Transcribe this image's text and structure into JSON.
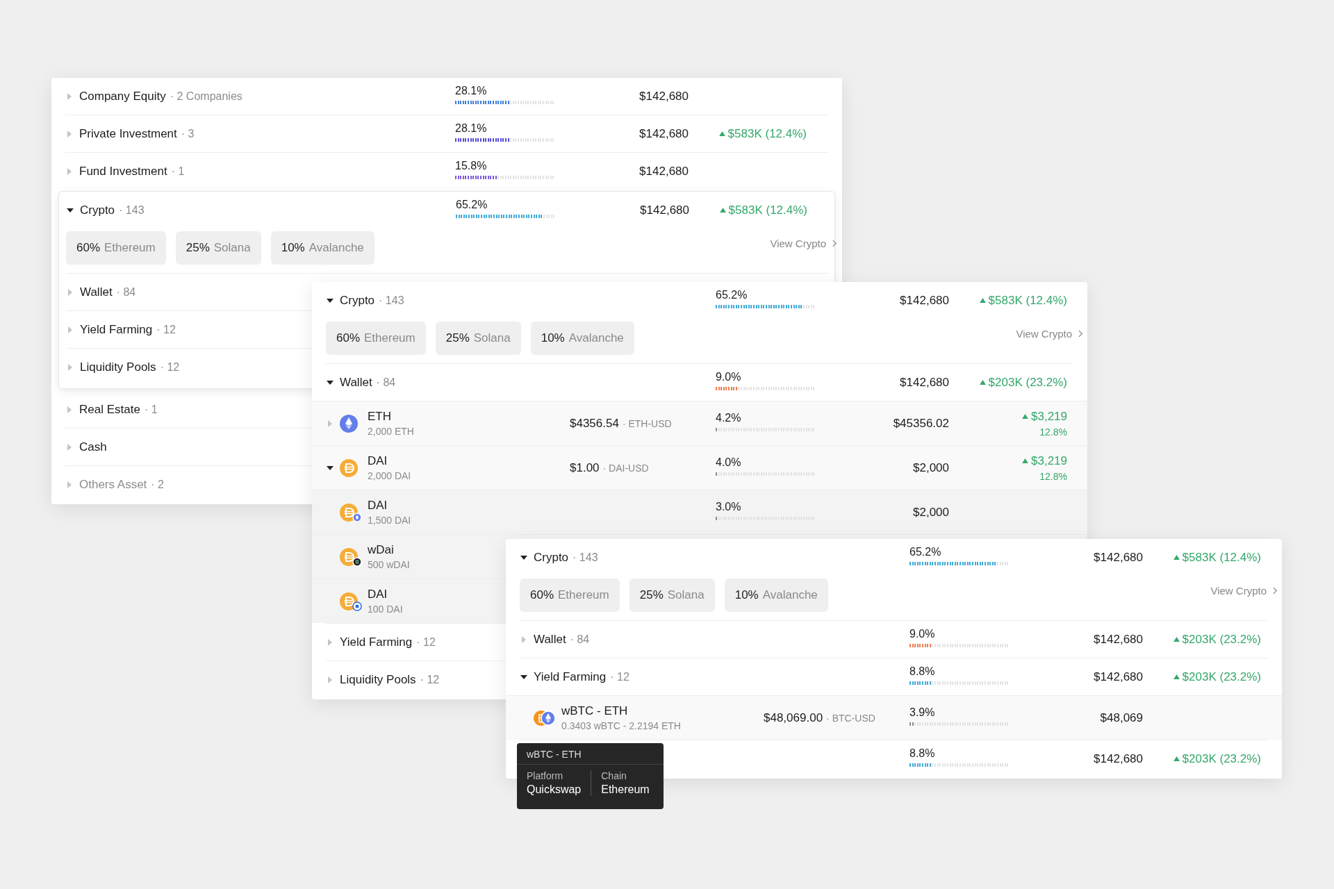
{
  "panels": [
    {
      "rows": [
        {
          "name": "Company Equity",
          "count": "· 2 Companies",
          "expanded": false,
          "pct": "28.1%",
          "level": 0.55,
          "color": "#3d7fd9",
          "value": "$142,680"
        },
        {
          "name": "Private Investment",
          "count": "· 3",
          "expanded": false,
          "pct": "28.1%",
          "level": 0.55,
          "color": "#5447d6",
          "value": "$142,680",
          "change": "$583K (12.4%)"
        },
        {
          "name": "Fund Investment",
          "count": "· 1",
          "expanded": false,
          "pct": "15.8%",
          "level": 0.43,
          "color": "#7a55e0",
          "value": "$142,680"
        },
        {
          "name": "Crypto",
          "count": "· 143",
          "expanded": true,
          "pct": "65.2%",
          "level": 0.87,
          "color": "#3fa9d6",
          "value": "$142,680",
          "change": "$583K (12.4%)",
          "allocations": [
            {
              "share": "60%",
              "name": "Ethereum"
            },
            {
              "share": "25%",
              "name": "Solana"
            },
            {
              "share": "10%",
              "name": "Avalanche"
            }
          ],
          "link": "View Crypto",
          "children": [
            {
              "name": "Wallet",
              "count": "· 84",
              "expanded": false
            },
            {
              "name": "Yield Farming",
              "count": "· 12",
              "expanded": false
            },
            {
              "name": "Liquidity Pools",
              "count": "· 12",
              "expanded": false
            }
          ]
        },
        {
          "name": "Real Estate",
          "count": "· 1",
          "expanded": false
        },
        {
          "name": "Cash",
          "expanded": false
        },
        {
          "name": "Others Asset",
          "count": "· 2",
          "expanded": false,
          "muted": true
        }
      ]
    },
    {
      "rows": [
        {
          "name": "Crypto",
          "count": "· 143",
          "expanded": true,
          "pct": "65.2%",
          "level": 0.87,
          "color": "#3fa9d6",
          "value": "$142,680",
          "change": "$583K (12.4%)",
          "allocations": [
            {
              "share": "60%",
              "name": "Ethereum"
            },
            {
              "share": "25%",
              "name": "Solana"
            },
            {
              "share": "10%",
              "name": "Avalanche"
            }
          ],
          "link": "View Crypto",
          "children": [
            {
              "name": "Wallet",
              "count": "· 84",
              "expanded": true,
              "pct": "9.0%",
              "level": 0.22,
              "color": "#ef7b4d",
              "value": "$142,680",
              "change": "$203K (23.2%)",
              "children": [
                {
                  "name": "ETH",
                  "sub": "2,000 ETH",
                  "kind": "eth",
                  "expanded": false,
                  "price": "$4356.54",
                  "pair": "· ETH-USD",
                  "pct": "4.2%",
                  "level": 0.03,
                  "color": "#8a8a8a",
                  "value": "$45356.02",
                  "change": "$3,219",
                  "change_pct": "12.8%"
                },
                {
                  "name": "DAI",
                  "sub": "2,000 DAI",
                  "kind": "dai",
                  "expanded": true,
                  "price": "$1.00",
                  "pair": "· DAI-USD",
                  "pct": "4.0%",
                  "level": 0.03,
                  "color": "#8a8a8a",
                  "value": "$2,000",
                  "change": "$3,219",
                  "change_pct": "12.8%",
                  "children": [
                    {
                      "name": "DAI",
                      "sub": "1,500 DAI",
                      "kind": "dai-chain",
                      "pct": "3.0%",
                      "level": 0.03,
                      "color": "#8a8a8a",
                      "value": "$2,000"
                    },
                    {
                      "name": "wDai",
                      "sub": "500 wDAI",
                      "kind": "dai-chain"
                    },
                    {
                      "name": "DAI",
                      "sub": "100 DAI",
                      "kind": "dai-chain"
                    }
                  ]
                }
              ]
            },
            {
              "name": "Yield Farming",
              "count": "· 12",
              "expanded": false
            },
            {
              "name": "Liquidity Pools",
              "count": "· 12",
              "expanded": false
            }
          ]
        }
      ]
    },
    {
      "rows": [
        {
          "name": "Crypto",
          "count": "· 143",
          "expanded": true,
          "pct": "65.2%",
          "level": 0.87,
          "color": "#3fa9d6",
          "value": "$142,680",
          "change": "$583K (12.4%)",
          "allocations": [
            {
              "share": "60%",
              "name": "Ethereum"
            },
            {
              "share": "25%",
              "name": "Solana"
            },
            {
              "share": "10%",
              "name": "Avalanche"
            }
          ],
          "link": "View Crypto",
          "children": [
            {
              "name": "Wallet",
              "count": "· 84",
              "expanded": false,
              "pct": "9.0%",
              "level": 0.22,
              "color": "#ef7b4d",
              "value": "$142,680",
              "change": "$203K (23.2%)"
            },
            {
              "name": "Yield Farming",
              "count": "· 12",
              "expanded": true,
              "pct": "8.8%",
              "level": 0.22,
              "color": "#3fa9d6",
              "value": "$142,680",
              "change": "$203K (23.2%)",
              "children": [
                {
                  "name": "wBTC - ETH",
                  "sub": "0.3403 wBTC - 2.2194 ETH",
                  "kind": "pair",
                  "price": "$48,069.00",
                  "pair": "· BTC-USD",
                  "pct": "3.9%",
                  "level": 0.04,
                  "color": "#8a8a8a",
                  "value": "$48,069"
                }
              ]
            },
            {
              "pct": "8.8%",
              "level": 0.22,
              "color": "#3fa9d6",
              "value": "$142,680",
              "change": "$203K (23.2%)"
            }
          ]
        }
      ]
    }
  ],
  "tooltip": {
    "title": "wBTC - ETH",
    "fields": [
      {
        "label": "Platform",
        "value": "Quickswap"
      },
      {
        "label": "Chain",
        "value": "Ethereum"
      }
    ]
  }
}
